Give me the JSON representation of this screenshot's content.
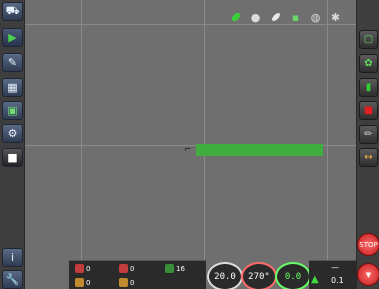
{
  "left_toolbar": {
    "items": [
      {
        "name": "home",
        "icon": "tractor-icon"
      },
      {
        "name": "play",
        "icon": "arrow-icon"
      },
      {
        "name": "tools",
        "icon": "wrench-icon"
      },
      {
        "name": "map",
        "icon": "map-icon"
      },
      {
        "name": "field",
        "icon": "field-icon"
      },
      {
        "name": "implement",
        "icon": "implement-icon"
      },
      {
        "name": "stop",
        "icon": "square-icon"
      }
    ],
    "bottom_items": [
      {
        "name": "info",
        "icon": "info-icon"
      },
      {
        "name": "settings",
        "icon": "settings-wrench-icon"
      }
    ]
  },
  "top_bar": {
    "icons": [
      "leaf-icon",
      "dot-icon",
      "feather-icon",
      "flag-icon",
      "circle-icon",
      "gear-icon"
    ]
  },
  "right_toolbar": {
    "items": [
      "page-icon",
      "plant-icon",
      "layer-icon",
      "red-square-icon",
      "pen-icon",
      "arrows-icon"
    ],
    "stop_label": "STOP"
  },
  "status": {
    "row1": [
      "0",
      "0",
      "16"
    ],
    "row2": [
      "0",
      "0",
      ""
    ],
    "gauges": [
      "20.0",
      "270°",
      "0.0"
    ],
    "right_value": "0.1",
    "right_top": "—"
  },
  "colors": {
    "guidance": "#3fae3f",
    "background": "#6f6f6f"
  }
}
